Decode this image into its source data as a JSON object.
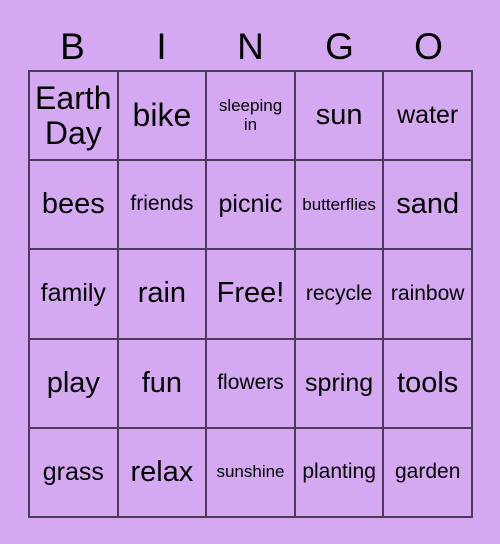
{
  "card": {
    "title_letters": [
      "B",
      "I",
      "N",
      "G",
      "O"
    ],
    "columns": 5,
    "rows": 5,
    "background_color": "#d4a9f2",
    "cell_color": "#d4a9f2",
    "border_color": "#4b3a5c",
    "text_color": "#000000",
    "cells": [
      {
        "text": "Earth\nDay",
        "size": "fs-xl"
      },
      {
        "text": "bike",
        "size": "fs-xl"
      },
      {
        "text": "sleeping\nin",
        "size": "fs-xs"
      },
      {
        "text": "sun",
        "size": "fs-lg"
      },
      {
        "text": "water",
        "size": "fs-md"
      },
      {
        "text": "bees",
        "size": "fs-lg"
      },
      {
        "text": "friends",
        "size": "fs-sm"
      },
      {
        "text": "picnic",
        "size": "fs-md"
      },
      {
        "text": "butterflies",
        "size": "fs-xs"
      },
      {
        "text": "sand",
        "size": "fs-lg"
      },
      {
        "text": "family",
        "size": "fs-md"
      },
      {
        "text": "rain",
        "size": "fs-lg"
      },
      {
        "text": "Free!",
        "size": "fs-lg"
      },
      {
        "text": "recycle",
        "size": "fs-sm"
      },
      {
        "text": "rainbow",
        "size": "fs-sm"
      },
      {
        "text": "play",
        "size": "fs-lg"
      },
      {
        "text": "fun",
        "size": "fs-lg"
      },
      {
        "text": "flowers",
        "size": "fs-sm"
      },
      {
        "text": "spring",
        "size": "fs-md"
      },
      {
        "text": "tools",
        "size": "fs-lg"
      },
      {
        "text": "grass",
        "size": "fs-md"
      },
      {
        "text": "relax",
        "size": "fs-lg"
      },
      {
        "text": "sunshine",
        "size": "fs-xs"
      },
      {
        "text": "planting",
        "size": "fs-sm"
      },
      {
        "text": "garden",
        "size": "fs-sm"
      }
    ]
  }
}
